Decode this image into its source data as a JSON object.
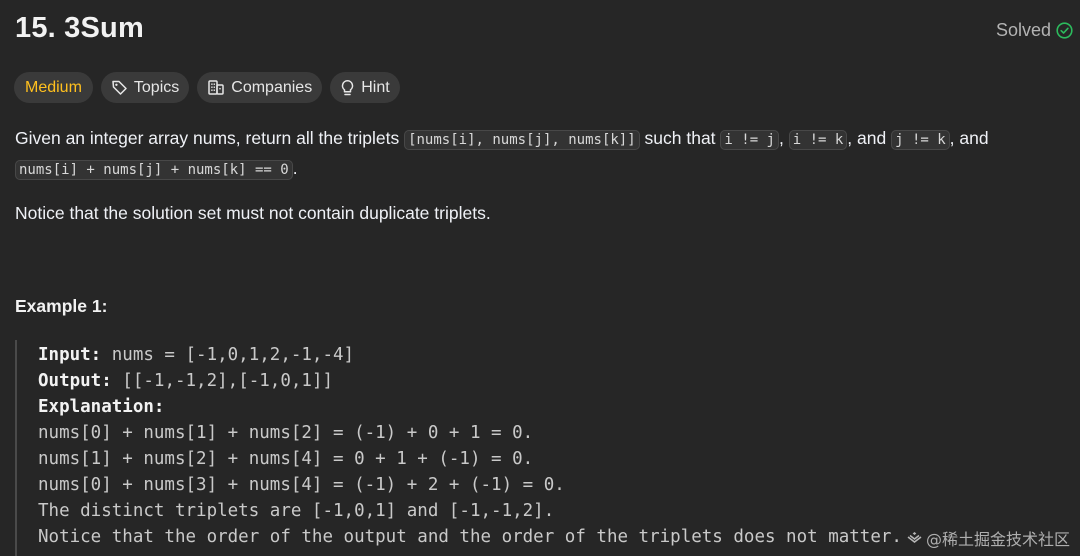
{
  "problem": {
    "title": "15. 3Sum",
    "status": "Solved"
  },
  "tags": {
    "difficulty": "Medium",
    "topics": "Topics",
    "companies": "Companies",
    "hint": "Hint"
  },
  "description": {
    "p1_text_1": "Given an integer array nums, return all the triplets ",
    "p1_code_1": "[nums[i], nums[j], nums[k]]",
    "p1_text_2": " such that ",
    "p1_code_2": "i != j",
    "p1_text_3": ", ",
    "p1_code_3": "i != k",
    "p1_text_4": ", and ",
    "p1_code_4": "j != k",
    "p1_text_5": ", and ",
    "p1_code_5": "nums[i] + nums[j] + nums[k] == 0",
    "p1_text_6": ".",
    "p2": "Notice that the solution set must not contain duplicate triplets."
  },
  "example": {
    "title": "Example 1:",
    "input_label": "Input:",
    "input_value": " nums = [-1,0,1,2,-1,-4]",
    "output_label": "Output:",
    "output_value": " [[-1,-1,2],[-1,0,1]]",
    "explanation_label": "Explanation:",
    "lines": [
      "nums[0] + nums[1] + nums[2] = (-1) + 0 + 1 = 0.",
      "nums[1] + nums[2] + nums[4] = 0 + 1 + (-1) = 0.",
      "nums[0] + nums[3] + nums[4] = (-1) + 2 + (-1) = 0.",
      "The distinct triplets are [-1,0,1] and [-1,-1,2].",
      "Notice that the order of the output and the order of the triplets does not matter."
    ]
  },
  "watermark": {
    "text": "@稀土掘金技术社区"
  },
  "colors": {
    "background": "#262626",
    "medium": "#ffc01e",
    "solved_check": "#2cbb5d"
  }
}
